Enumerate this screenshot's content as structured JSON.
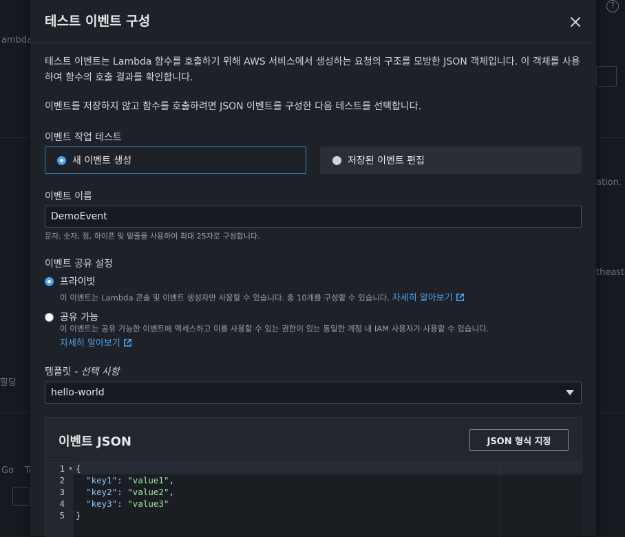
{
  "background": {
    "left_text_1": "ambda",
    "left_text_2": "할당",
    "left_text_3": "Go",
    "left_text_4": "Te",
    "right_text_1": "ation.",
    "right_text_2": "theast-"
  },
  "modal": {
    "title": "테스트 이벤트 구성",
    "close_icon": "close-icon",
    "description_1": "테스트 이벤트는 Lambda 함수를 호출하기 위해 AWS 서비스에서 생성하는 요청의 구조를 모방한 JSON 객체입니다. 이 객체를 사용하여 함수의 호출 결과를 확인합니다.",
    "description_2": "이벤트를 저장하지 않고 함수를 호출하려면 JSON 이벤트를 구성한 다음 테스트를 선택합니다.",
    "test_event_action": {
      "label": "이벤트 작업 테스트",
      "options": [
        {
          "label": "새 이벤트 생성",
          "selected": true
        },
        {
          "label": "저장된 이벤트 편집",
          "selected": false
        }
      ]
    },
    "event_name": {
      "label": "이벤트 이름",
      "value": "DemoEvent",
      "hint": "문자, 숫자, 점, 하이픈 및 밑줄을 사용하여 최대 25자로 구성합니다."
    },
    "sharing": {
      "label": "이벤트 공유 설정",
      "private": {
        "label": "프라이빗",
        "selected": true,
        "description": "이 이벤트는 Lambda 콘솔 및 이벤트 생성자만 사용할 수 있습니다. 총 10개를 구성할 수 있습니다.",
        "link": "자세히 알아보기"
      },
      "shareable": {
        "label": "공유 가능",
        "selected": false,
        "description": "이 이벤트는 공유 가능한 이벤트에 액세스하고 이를 사용할 수 있는 권한이 있는 동일한 계정 내 IAM 사용자가 사용할 수 있습니다.",
        "link": "자세히 알아보기"
      }
    },
    "template": {
      "label": "템플릿",
      "label_optional": "- 선택 사항",
      "value": "hello-world"
    },
    "event_json": {
      "title": "이벤트 JSON",
      "format_button": "JSON 형식 지정",
      "line_numbers": [
        "1",
        "2",
        "3",
        "4",
        "5"
      ],
      "lines": [
        {
          "brace": "{"
        },
        {
          "key": "\"key1\"",
          "value": "\"value1\"",
          "comma": ","
        },
        {
          "key": "\"key2\"",
          "value": "\"value2\"",
          "comma": ","
        },
        {
          "key": "\"key3\"",
          "value": "\"value3\"",
          "comma": ""
        },
        {
          "brace": "}"
        }
      ]
    }
  },
  "colors": {
    "accent": "#4aa3ef",
    "modal_bg": "#1e2127",
    "json_key": "#8ec5ff",
    "json_string": "#9ee6a0"
  }
}
